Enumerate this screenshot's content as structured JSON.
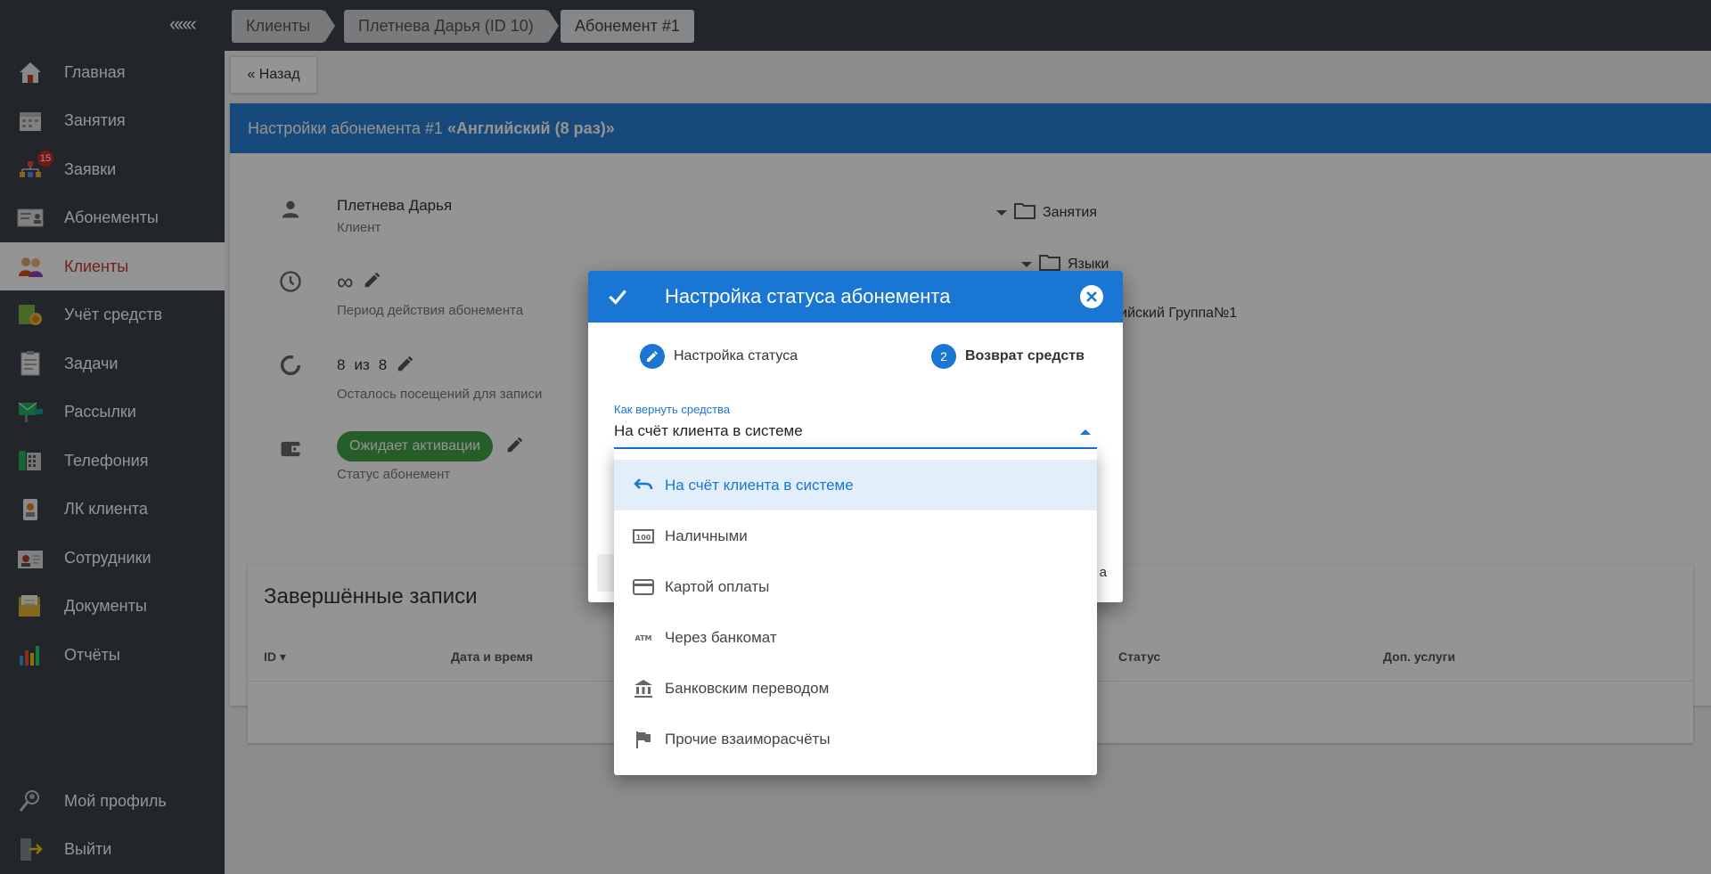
{
  "sidebar": {
    "collapse_label": "«««",
    "items": [
      {
        "label": "Главная",
        "icon": "home-icon"
      },
      {
        "label": "Занятия",
        "icon": "calendar-icon"
      },
      {
        "label": "Заявки",
        "icon": "requests-icon",
        "badge": "15"
      },
      {
        "label": "Абонементы",
        "icon": "subscription-card-icon"
      },
      {
        "label": "Клиенты",
        "icon": "clients-icon",
        "active": true
      },
      {
        "label": "Учёт средств",
        "icon": "money-icon"
      },
      {
        "label": "Задачи",
        "icon": "tasks-icon"
      },
      {
        "label": "Рассылки",
        "icon": "mailing-icon"
      },
      {
        "label": "Телефония",
        "icon": "phone-icon"
      },
      {
        "label": "ЛК клиента",
        "icon": "client-cabinet-icon"
      },
      {
        "label": "Сотрудники",
        "icon": "staff-icon"
      },
      {
        "label": "Документы",
        "icon": "documents-icon"
      },
      {
        "label": "Отчёты",
        "icon": "reports-icon"
      }
    ],
    "bottom": [
      {
        "label": "Мой профиль",
        "icon": "profile-icon"
      },
      {
        "label": "Выйти",
        "icon": "logout-icon"
      }
    ]
  },
  "breadcrumbs": [
    "Клиенты",
    "Плетнева Дарья (ID 10)",
    "Абонемент #1"
  ],
  "back_label": "« Назад",
  "panel": {
    "title_prefix": "Настройки абонемента #1",
    "title_name": "«Английский (8 раз)»",
    "client_name": "Плетнева Дарья",
    "client_caption": "Клиент",
    "period_value": "∞",
    "period_caption": "Период действия абонемента",
    "visits_left": "8",
    "visits_sep": "из",
    "visits_total": "8",
    "visits_caption": "Осталось посещений для записи",
    "status_chip": "Ожидает активации",
    "status_caption": "Статус абонемент",
    "tree": [
      "Занятия",
      "Языки",
      "...глийский Группа№1"
    ]
  },
  "completed": {
    "title": "Завершённые записи",
    "columns": [
      "ID",
      "Дата и время",
      "Статус",
      "Доп. услуги"
    ]
  },
  "dialog": {
    "title": "Настройка статуса абонемента",
    "step1_label": "Настройка статуса",
    "step2_num": "2",
    "step2_label": "Возврат средств",
    "select_label": "Как вернуть средства",
    "select_value": "На счёт клиента в системе",
    "footer_right": "а"
  },
  "menu": {
    "options": [
      {
        "label": "На счёт клиента в системе",
        "icon": "undo-icon",
        "selected": true
      },
      {
        "label": "Наличными",
        "icon": "cash-icon"
      },
      {
        "label": "Картой оплаты",
        "icon": "credit-card-icon"
      },
      {
        "label": "Через банкомат",
        "icon": "atm-icon"
      },
      {
        "label": "Банковским переводом",
        "icon": "bank-icon"
      },
      {
        "label": "Прочие взаиморасчёты",
        "icon": "flag-icon"
      }
    ]
  },
  "colors": {
    "sidebar": "#3b4148",
    "accent": "#1976d2",
    "panel_header": "#2a7fd4",
    "active_text": "#c0392b",
    "chip": "#43a047"
  }
}
